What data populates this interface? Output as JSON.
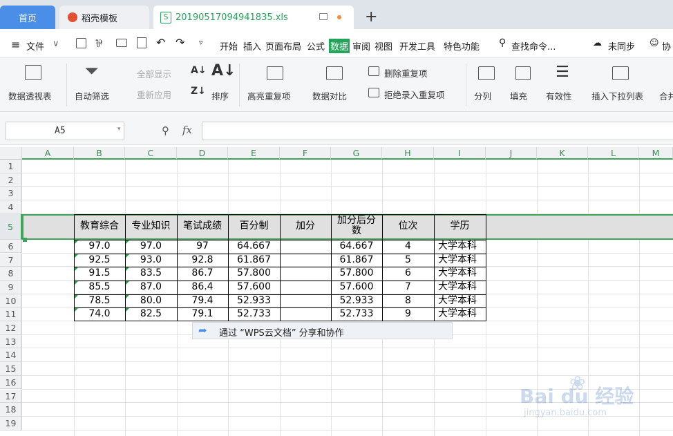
{
  "tabs": {
    "home": "首页",
    "template": "稻壳模板",
    "file": "20190517094941835.xls",
    "new_tab": "+"
  },
  "menu": {
    "file": "文件",
    "items": [
      "开始",
      "插入",
      "页面布局",
      "公式",
      "数据",
      "审阅",
      "视图",
      "开发工具",
      "特色功能"
    ],
    "search": "查找命令...",
    "sync": "未同步",
    "collab": "协"
  },
  "ribbon": {
    "pivot": "数据透视表",
    "autofilter": "自动筛选",
    "show_all": "全部显示",
    "reapply": "重新应用",
    "sort": "排序",
    "highlight_dup": "高亮重复项",
    "compare": "数据对比",
    "remove_dup": "删除重复项",
    "reject_dup": "拒绝录入重复项",
    "split": "分列",
    "fill": "填充",
    "validity": "有效性",
    "dropdown": "插入下拉列表",
    "merge": "合并"
  },
  "namebox": "A5",
  "fx": "fx",
  "columns": [
    "A",
    "B",
    "C",
    "D",
    "E",
    "F",
    "G",
    "H",
    "I",
    "J",
    "K",
    "L",
    "M"
  ],
  "rows": [
    "1",
    "2",
    "3",
    "4",
    "5",
    "6",
    "7",
    "8",
    "9",
    "10",
    "11",
    "12",
    "13",
    "14",
    "15",
    "16",
    "17",
    "18",
    "19"
  ],
  "table": {
    "headers": [
      "教育综合",
      "专业知识",
      "笔试成绩",
      "百分制",
      "加分",
      "加分后分数",
      "位次",
      "学历"
    ],
    "rows": [
      [
        "97.0",
        "97.0",
        "97",
        "64.667",
        "",
        "64.667",
        "4",
        "大学本科"
      ],
      [
        "92.5",
        "93.0",
        "92.8",
        "61.867",
        "",
        "61.867",
        "5",
        "大学本科"
      ],
      [
        "91.5",
        "83.5",
        "86.7",
        "57.800",
        "",
        "57.800",
        "6",
        "大学本科"
      ],
      [
        "85.5",
        "87.0",
        "86.4",
        "57.600",
        "",
        "57.600",
        "7",
        "大学本科"
      ],
      [
        "78.5",
        "80.0",
        "79.4",
        "52.933",
        "",
        "52.933",
        "8",
        "大学本科"
      ],
      [
        "74.0",
        "82.5",
        "79.1",
        "52.733",
        "",
        "52.733",
        "9",
        "大学本科"
      ]
    ]
  },
  "share_tip": "通过 “WPS云文档” 分享和协作",
  "watermark": {
    "brand": "Bai du 经验",
    "url": "jingyan.baidu.com"
  },
  "colors": {
    "accent": "#4a8ee8",
    "active_tab": "#22a55a",
    "selection": "#3fa35a"
  }
}
